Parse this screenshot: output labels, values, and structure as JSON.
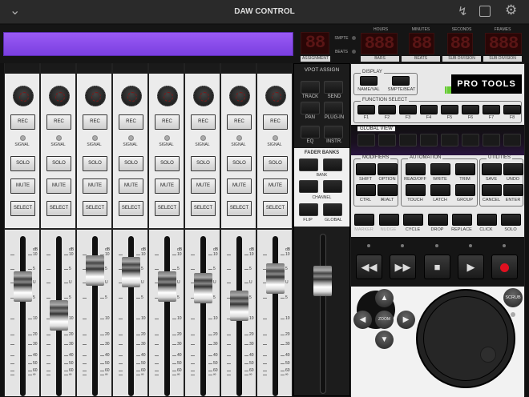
{
  "header": {
    "title": "DAW CONTROL",
    "icons": [
      "chevron-down-icon",
      "bolt-icon",
      "box-icon",
      "gear-icon"
    ]
  },
  "lcd": {
    "assignment_digits": "88",
    "assignment_label": "ASSIGNMENT",
    "smpte_label": "SMPTE",
    "beats_label": "BEATS",
    "time_headers": [
      "HOURS",
      "MINUTES",
      "SECONDS",
      "FRAMES"
    ],
    "time_digits": [
      "888",
      "88",
      "88",
      "888"
    ],
    "time_labels": [
      "BARS",
      "BEATS",
      "SUB DIVISION",
      "SUB DIVISION"
    ]
  },
  "strip": {
    "rec": "REC",
    "signal": "SIGNAL",
    "solo": "SOLO",
    "mute": "MUTE",
    "select": "SELECT"
  },
  "channels": [
    {
      "fader": 0.69
    },
    {
      "fader": 0.51
    },
    {
      "fader": 0.79
    },
    {
      "fader": 0.78
    },
    {
      "fader": 0.69
    },
    {
      "fader": 0.68
    },
    {
      "fader": 0.57
    },
    {
      "fader": 0.74
    }
  ],
  "scale": [
    "dB",
    "10",
    "5",
    "U",
    "5",
    "10",
    "20",
    "30",
    "40",
    "50",
    "60",
    "∞"
  ],
  "master_fader": 0.72,
  "vpot": {
    "title": "VPOT ASSIGN",
    "buttons": [
      "TRACK",
      "SEND",
      "PAN",
      "PLUG-IN",
      "EQ",
      "INSTR."
    ]
  },
  "fader_banks": {
    "title": "FADER BANKS",
    "bank": "BANK",
    "channel": "CHANNEL",
    "flip": "FLIP",
    "global": "GLOBAL"
  },
  "display": {
    "title": "DISPLAY",
    "name_val": "NAME/VAL",
    "smpte_beat": "SMPTE/BEAT",
    "logo": "PRO TOOLS"
  },
  "function_select": {
    "title": "FUNCTION SELECT",
    "keys": [
      "F1",
      "F2",
      "F3",
      "F4",
      "F5",
      "F6",
      "F7",
      "F8"
    ]
  },
  "global_view": {
    "title": "GLOBAL VIEW"
  },
  "modifiers": {
    "title": "MODIFIERS",
    "keys": [
      "SHIFT",
      "OPTION",
      "CTRL",
      "⌘/ALT"
    ]
  },
  "automation": {
    "title": "AUTOMATION",
    "keys": [
      "READ/OFF",
      "WRITE",
      "TRIM",
      "TOUCH",
      "LATCH",
      "GROUP"
    ]
  },
  "utilities": {
    "title": "UTILITIES",
    "keys": [
      "SAVE",
      "UNDO",
      "CANCEL",
      "ENTER"
    ]
  },
  "bottom_row": [
    "MARKER",
    "NUDGE",
    "CYCLE",
    "DROP",
    "REPLACE",
    "CLICK",
    "SOLO"
  ],
  "transport": {
    "icons": [
      "rewind-icon",
      "fast-forward-icon",
      "stop-icon",
      "play-icon",
      "record-icon"
    ],
    "record_color": "#e01020"
  },
  "nav": {
    "zoom": "ZOOM",
    "scrub": "SCRUB"
  }
}
